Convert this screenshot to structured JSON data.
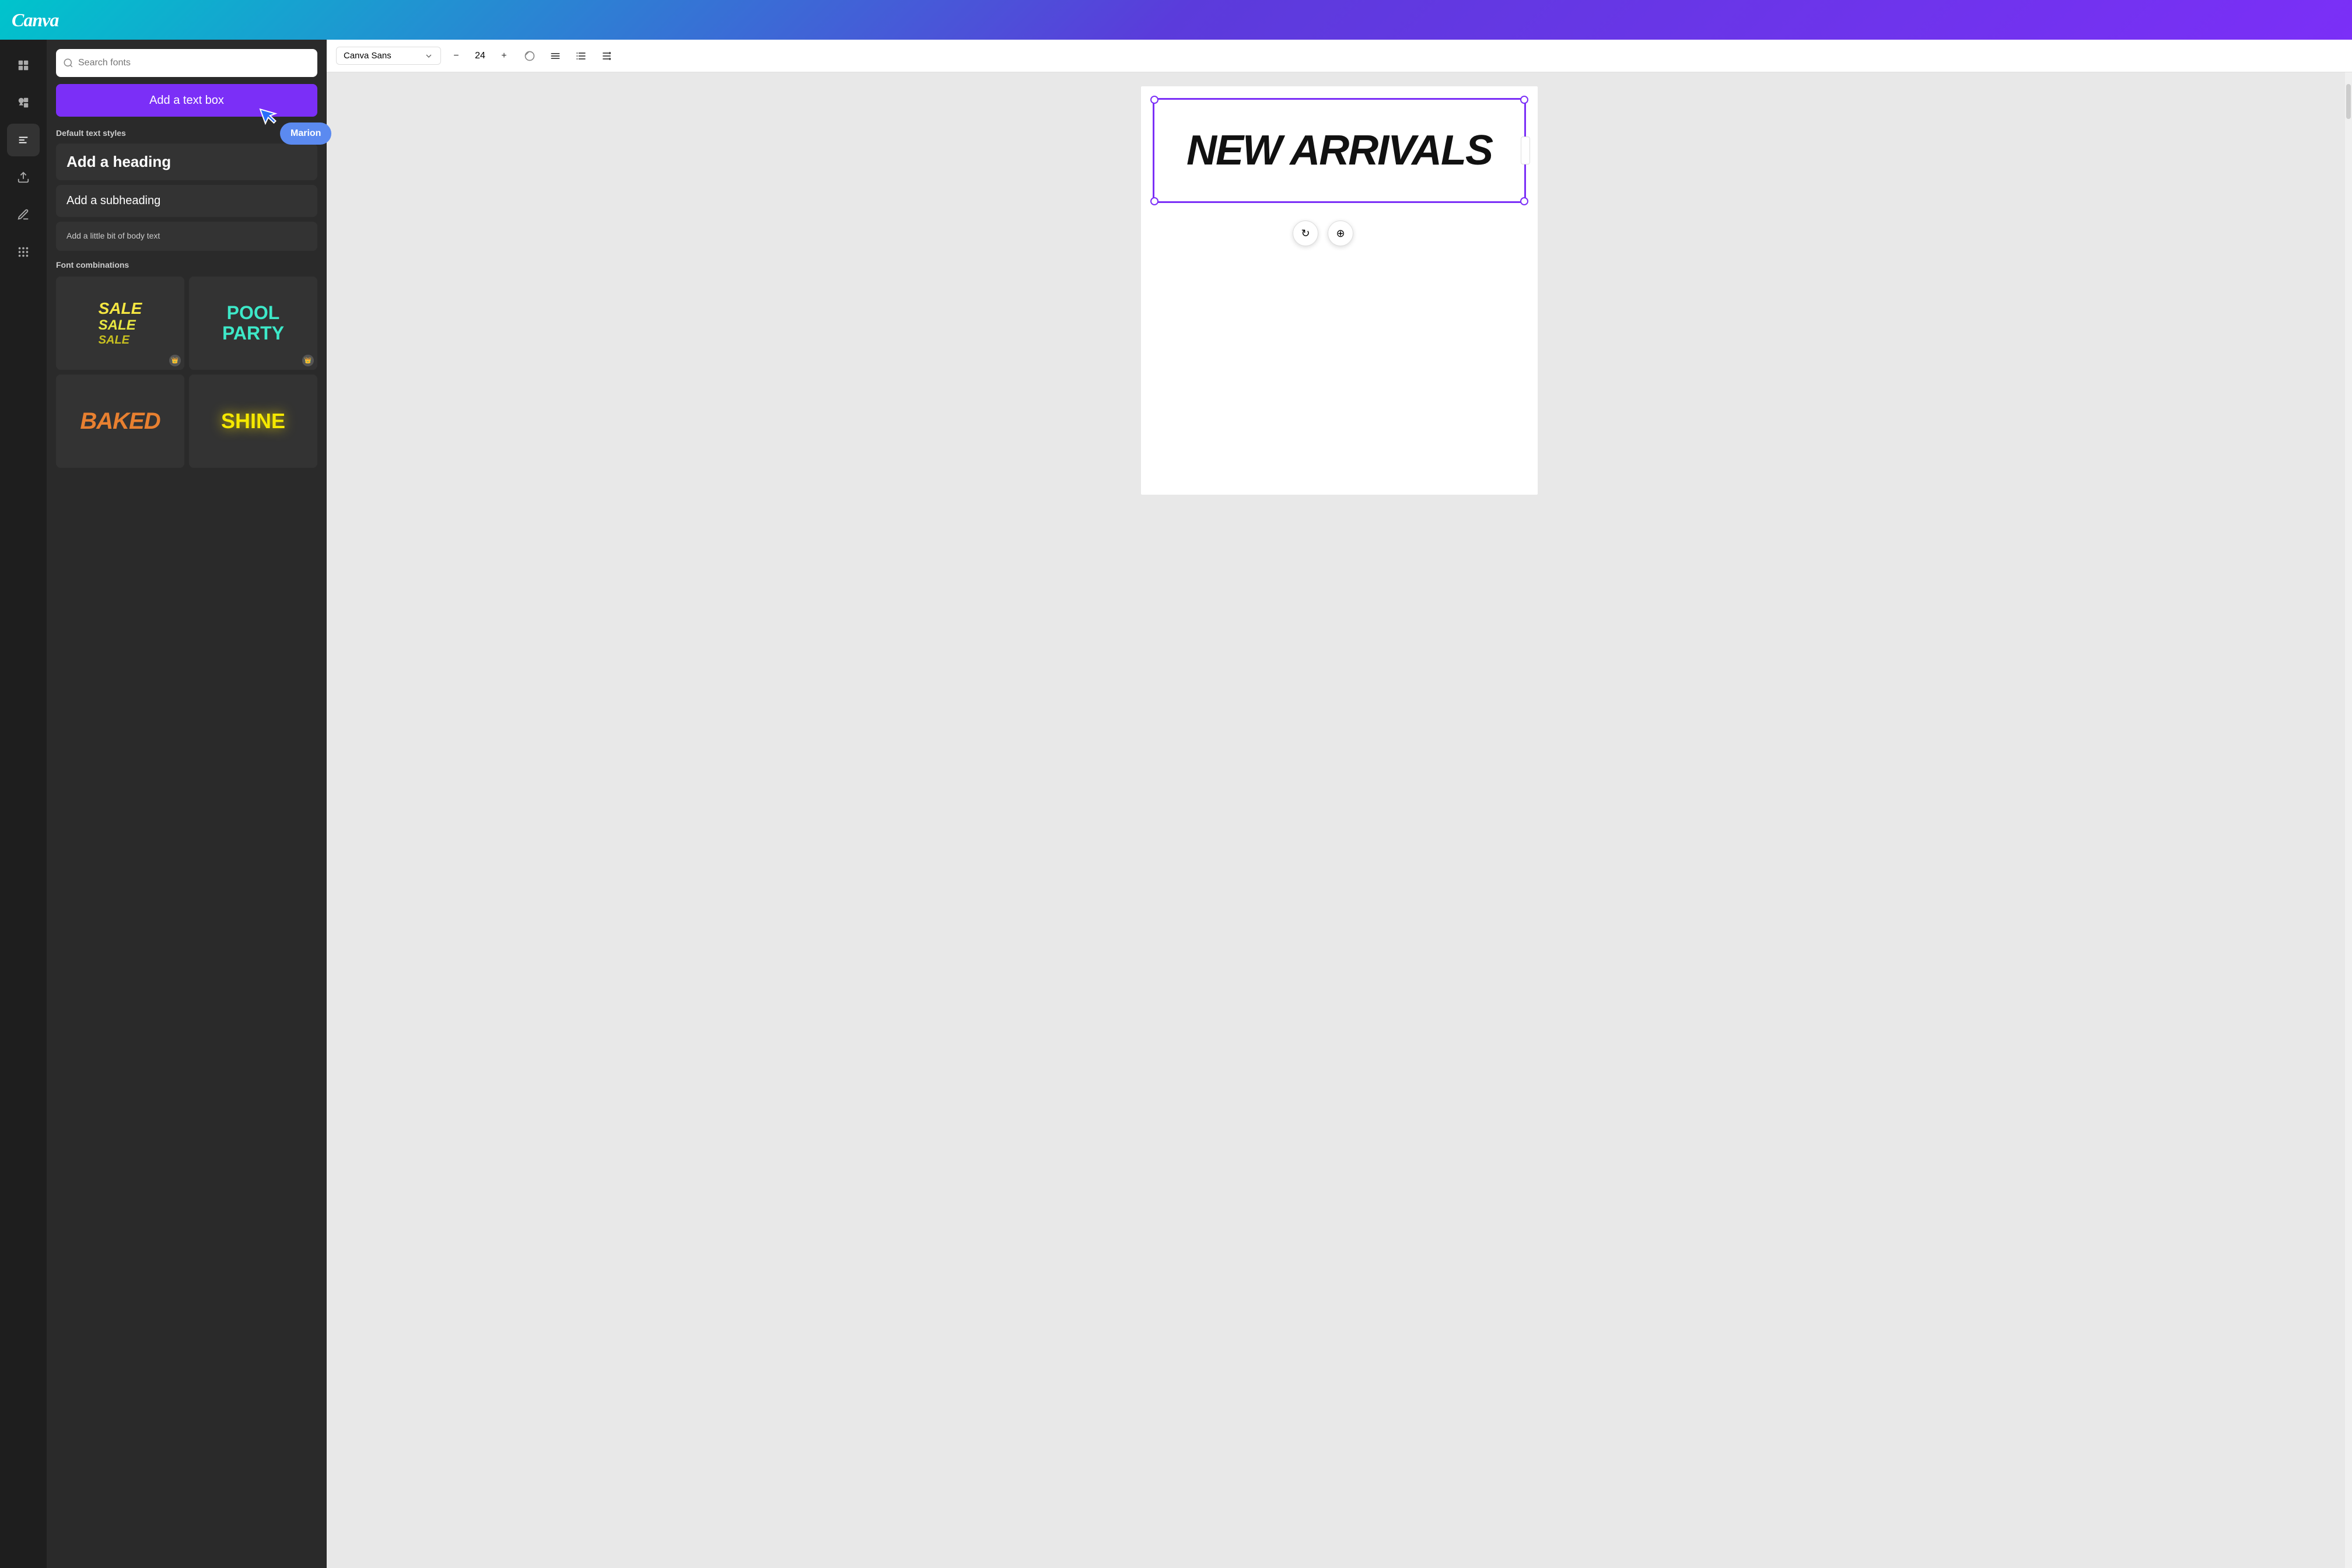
{
  "header": {
    "logo": "Canva"
  },
  "toolbar": {
    "font_name": "Canva Sans",
    "font_size": "24",
    "decrease_label": "−",
    "increase_label": "+",
    "align_label": "≡",
    "list_label": "≡",
    "spacing_label": "↕"
  },
  "sidebar": {
    "icons": [
      {
        "name": "grid-icon",
        "label": "Templates"
      },
      {
        "name": "elements-icon",
        "label": "Elements"
      },
      {
        "name": "text-icon",
        "label": "Text"
      },
      {
        "name": "upload-icon",
        "label": "Uploads"
      },
      {
        "name": "draw-icon",
        "label": "Draw"
      },
      {
        "name": "apps-icon",
        "label": "Apps"
      }
    ]
  },
  "text_panel": {
    "search_placeholder": "Search fonts",
    "add_textbox_label": "Add a text box",
    "default_styles_title": "Default text styles",
    "heading_label": "Add a heading",
    "subheading_label": "Add a subheading",
    "body_label": "Add a little bit of body text",
    "font_combinations_title": "Font combinations",
    "combo1_line1": "SALE",
    "combo1_line2": "SALE",
    "combo1_line3": "SALE",
    "combo2_line1": "POOL",
    "combo2_line2": "PARTY",
    "combo3_label": "BAKED",
    "combo4_label": "SHINE"
  },
  "canvas": {
    "text_content": "NEW ARRIVALS",
    "tooltip_label": "Marion"
  },
  "action_buttons": {
    "rotate_icon": "↻",
    "move_icon": "⊕"
  }
}
